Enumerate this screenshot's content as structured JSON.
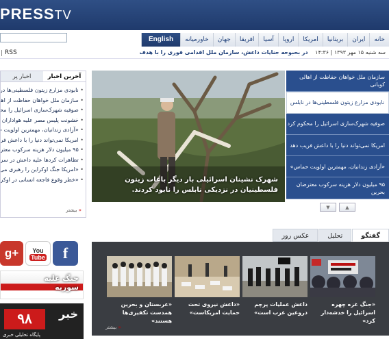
{
  "header": {
    "logo_text": "PRESS",
    "logo_tv": "TV"
  },
  "nav": {
    "items": [
      "خانه",
      "ایران",
      "بریتانیا",
      "امریکا",
      "اروپا",
      "آسیا",
      "افریقا",
      "جهان",
      "خاورمیانه"
    ],
    "english": "English"
  },
  "topline": {
    "rss": "RSS",
    "date": "سه شنبه ۱۵ مهر ۱۳۹۳ | ۱۴:۳۶",
    "headline": "در بحبوحه جنایات داعش، سازمان ملل اقدامی فوری را با هدف"
  },
  "latest": {
    "tab_latest": "آخرین اخبار",
    "tab_popular": "اخبار پر",
    "items": [
      "نابودی مزارع زیتون فلسطینی‌ها در نابلس",
      "سازمان ملل خواهان حفاظت از اهالی کوبانی",
      "صوفیه شهرک‌سازی اسرائیل را محکوم کرد",
      "خشونت پلیس مصر علیه هواداران مرسی",
      "«آزادی زندانیان، مهمترین اولویت حماس»",
      "امریکا نمی‌تواند دنیا را با داعش فریب دهد",
      "۹۵ میلیون دلار هزینه سرکوب معترضان",
      "تظاهرات کردها علیه داعش در سراسر اروپا",
      "«امریکا جنگ اوکراین را رهبری می‌کند»",
      "«خطر وقوع فاجعه انسانی در اوکراین»"
    ],
    "more": "بیشتر"
  },
  "hero": {
    "caption": "شهرک نشینان اسرائیلی بار دیگر باغات زیتون فلسطینیان در نزدیکی نابلس را نابود کردند."
  },
  "headlines": [
    "سازمان ملل خواهان حفاظت از اهالی کوبانی",
    "نابودی مزارع زیتون فلسطینی‌ها در نابلس",
    "صوفیه شهرک‌سازی اسرائیل را محکوم کرد",
    "امریکا نمی‌تواند دنیا را با داعش فریب دهد",
    "«آزادی زندانیان، مهمترین اولویت حماس»",
    "۹۵ میلیون دلار هزینه سرکوب معترضان بحرین"
  ],
  "pager": {
    "up": "▲",
    "down": "▼"
  },
  "social": {
    "gplus": "g+",
    "yt_you": "You",
    "yt_tube": "Tube",
    "fb": "f"
  },
  "banner_syria": {
    "line1": "جنگ علیه",
    "line2": "سوریه"
  },
  "banner_news": {
    "number": "۹۸",
    "word": "خبر",
    "caption": "پایگاه تحلیلی خبری"
  },
  "media": {
    "tabs": [
      "گفتگو",
      "تحلیل",
      "عکس روز"
    ],
    "captions": [
      "«جنگ غزه چهره اسرائیل را خدشه‌دار کرد»",
      "داعش عملیات پرچم دروغین غرب است»",
      "«داعش نیروی تحت حمایت امریکاست»",
      "«عربستان و بحرین همدست تکفیری‌ها هستند»"
    ],
    "more": "بیشتر"
  },
  "colors": {
    "brand_blue": "#2a4f8e",
    "accent_red": "#cc1b1b"
  }
}
